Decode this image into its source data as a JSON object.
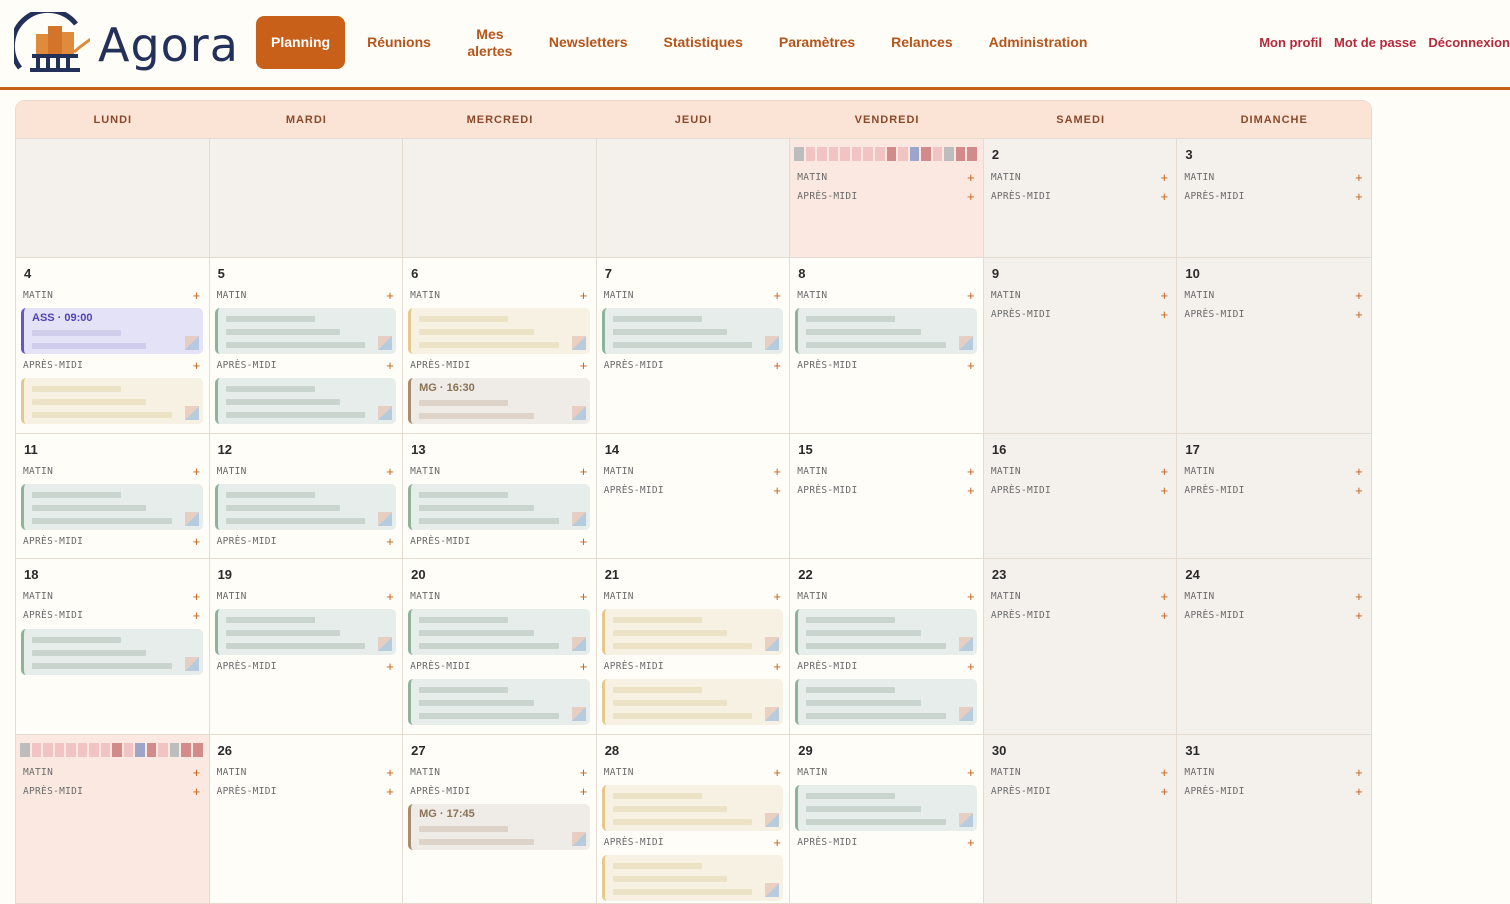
{
  "app": {
    "name": "Agora"
  },
  "nav": {
    "planning": "Planning",
    "reunions": "Réunions",
    "alertes": "Mes alertes",
    "newsletters": "Newsletters",
    "statistiques": "Statistiques",
    "parametres": "Paramètres",
    "relances": "Relances",
    "administration": "Administration"
  },
  "user": {
    "profil": "Mon profil",
    "password": "Mot de passe",
    "logout": "Déconnexion"
  },
  "days": [
    "LUNDI",
    "MARDI",
    "MERCREDI",
    "JEUDI",
    "VENDREDI",
    "SAMEDI",
    "DIMANCHE"
  ],
  "slot_labels": {
    "matin": "MATIN",
    "apres_midi": "APRÈS-MIDI"
  },
  "events": {
    "ass": "ASS · 09:00",
    "mg1": "MG · 16:30",
    "mg2": "MG · 17:45"
  },
  "weeks": [
    {
      "cells": [
        {
          "num": "",
          "type": "empty"
        },
        {
          "num": "",
          "type": "empty"
        },
        {
          "num": "",
          "type": "empty"
        },
        {
          "num": "",
          "type": "empty"
        },
        {
          "num": "",
          "type": "holiday"
        },
        {
          "num": "2",
          "type": "weekend"
        },
        {
          "num": "3",
          "type": "weekend"
        }
      ]
    },
    {
      "cells": [
        {
          "num": "4",
          "type": "day"
        },
        {
          "num": "5",
          "type": "day"
        },
        {
          "num": "6",
          "type": "day"
        },
        {
          "num": "7",
          "type": "day"
        },
        {
          "num": "8",
          "type": "day"
        },
        {
          "num": "9",
          "type": "weekend"
        },
        {
          "num": "10",
          "type": "weekend"
        }
      ]
    },
    {
      "cells": [
        {
          "num": "11",
          "type": "day"
        },
        {
          "num": "12",
          "type": "day"
        },
        {
          "num": "13",
          "type": "day"
        },
        {
          "num": "14",
          "type": "day"
        },
        {
          "num": "15",
          "type": "day"
        },
        {
          "num": "16",
          "type": "weekend"
        },
        {
          "num": "17",
          "type": "weekend"
        }
      ]
    },
    {
      "cells": [
        {
          "num": "18",
          "type": "day"
        },
        {
          "num": "19",
          "type": "day"
        },
        {
          "num": "20",
          "type": "day"
        },
        {
          "num": "21",
          "type": "day"
        },
        {
          "num": "22",
          "type": "day"
        },
        {
          "num": "23",
          "type": "weekend"
        },
        {
          "num": "24",
          "type": "weekend"
        }
      ]
    },
    {
      "cells": [
        {
          "num": "",
          "type": "holiday"
        },
        {
          "num": "26",
          "type": "day"
        },
        {
          "num": "27",
          "type": "day"
        },
        {
          "num": "28",
          "type": "day"
        },
        {
          "num": "29",
          "type": "day"
        },
        {
          "num": "30",
          "type": "weekend"
        },
        {
          "num": "31",
          "type": "weekend"
        }
      ]
    }
  ]
}
